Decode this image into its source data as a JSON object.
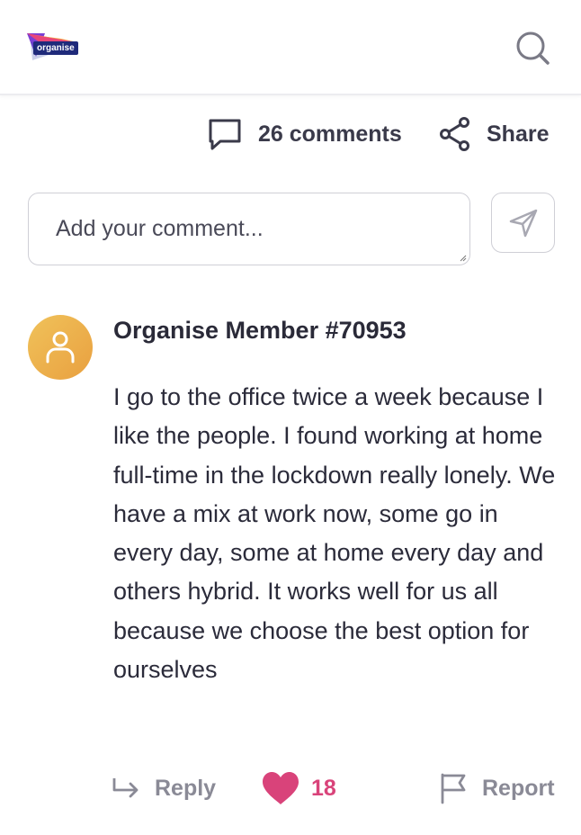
{
  "header": {
    "logo_text": "organise"
  },
  "actions": {
    "comments_label": "26 comments",
    "share_label": "Share"
  },
  "composer": {
    "placeholder": "Add your comment..."
  },
  "comment": {
    "author": "Organise Member #70953",
    "body": "I go to the office twice a week because I like the people. I found working at home full-time in the lockdown really lonely. We have a mix at work now, some go in every day, some at home every day and others hybrid. It works well for us all because we choose the best option for ourselves",
    "reply_label": "Reply",
    "like_count": "18",
    "report_label": "Report"
  },
  "icons": {
    "logo": "organise-logo",
    "search": "search-icon",
    "comments": "speech-bubble-icon",
    "share": "share-icon",
    "send": "paper-plane-icon",
    "avatar": "user-icon",
    "reply": "reply-arrow-icon",
    "like": "heart-icon",
    "report": "flag-icon"
  },
  "colors": {
    "brand_navy": "#1f2a7a",
    "avatar": "#eeb24e",
    "like": "#d9437a",
    "muted": "#8a8a96"
  }
}
